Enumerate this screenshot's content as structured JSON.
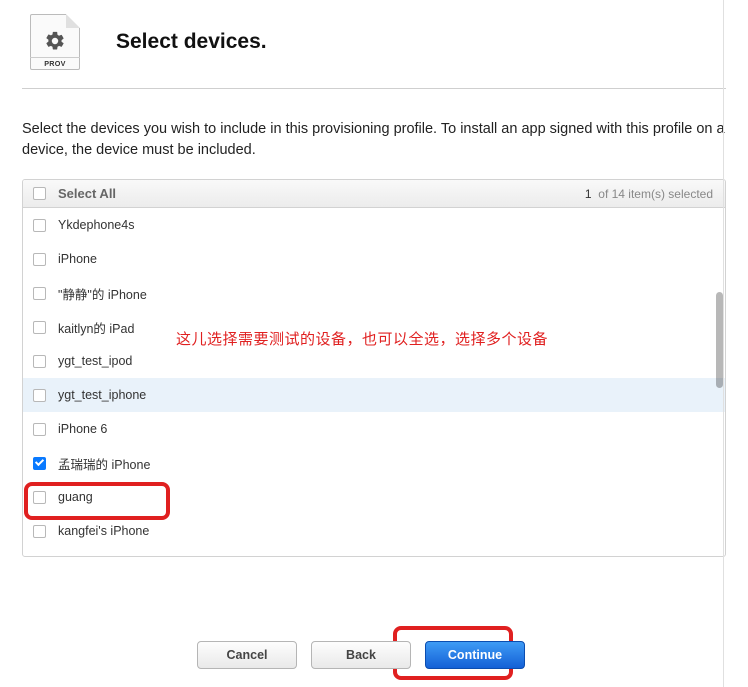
{
  "header": {
    "icon_label": "PROV",
    "title": "Select devices."
  },
  "instruction": "Select the devices you wish to include in this provisioning profile. To install an app signed with this profile on a device, the device must be included.",
  "list": {
    "select_all_label": "Select All",
    "selected_count": "1",
    "total_count_label": "of 14 item(s) selected",
    "items": [
      {
        "label": "Ykdephone4s",
        "checked": false,
        "highlighted": false
      },
      {
        "label": "iPhone",
        "checked": false,
        "highlighted": false
      },
      {
        "label": "\"静静\"的 iPhone",
        "checked": false,
        "highlighted": false
      },
      {
        "label": "kaitlyn的 iPad",
        "checked": false,
        "highlighted": false
      },
      {
        "label": "ygt_test_ipod",
        "checked": false,
        "highlighted": false
      },
      {
        "label": "ygt_test_iphone",
        "checked": false,
        "highlighted": true
      },
      {
        "label": "iPhone 6",
        "checked": false,
        "highlighted": false
      },
      {
        "label": "孟瑞瑞的 iPhone",
        "checked": true,
        "highlighted": false
      },
      {
        "label": "guang",
        "checked": false,
        "highlighted": false
      },
      {
        "label": "kangfei's iPhone",
        "checked": false,
        "highlighted": false
      }
    ]
  },
  "annotation": "这儿选择需要测试的设备，也可以全选，选择多个设备",
  "buttons": {
    "cancel": "Cancel",
    "back": "Back",
    "continue": "Continue"
  }
}
